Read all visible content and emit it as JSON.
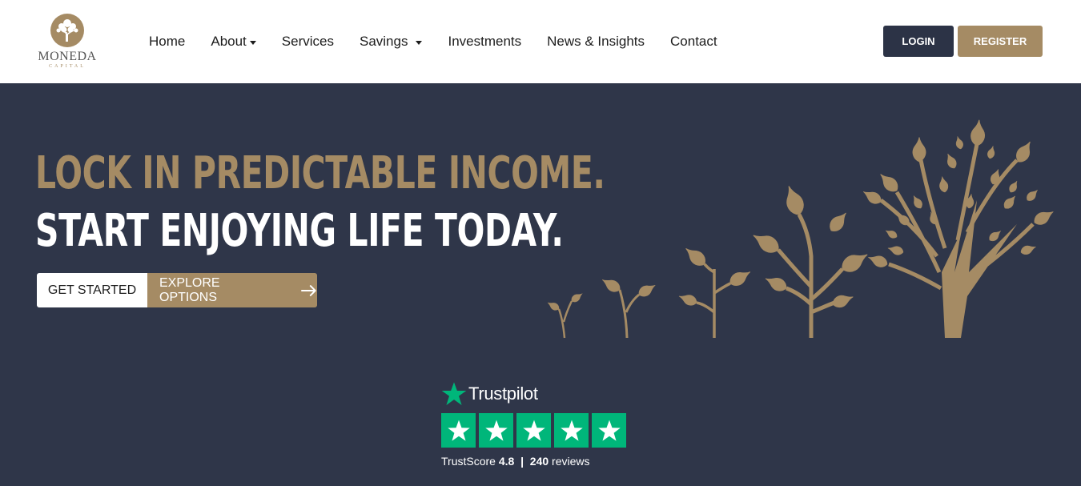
{
  "brand": {
    "name": "MONEDA",
    "sub": "CAPITAL",
    "color_gold": "#a58b64",
    "color_navy": "#2f3649"
  },
  "nav": {
    "items": [
      {
        "label": "Home",
        "dropdown": false
      },
      {
        "label": "About",
        "dropdown": true
      },
      {
        "label": "Services",
        "dropdown": false
      },
      {
        "label": "Savings",
        "dropdown": true
      },
      {
        "label": "Investments",
        "dropdown": false
      },
      {
        "label": "News & Insights",
        "dropdown": false
      },
      {
        "label": "Contact",
        "dropdown": false
      }
    ]
  },
  "auth": {
    "login_label": "LOGIN",
    "register_label": "REGISTER"
  },
  "hero": {
    "headline_1": "LOCK IN PREDICTABLE INCOME.",
    "headline_2": "START ENJOYING LIFE TODAY.",
    "get_started_label": "GET STARTED",
    "explore_label": "EXPLORE OPTIONS",
    "explore_icon": "arrow-right-icon",
    "illustration_icon": "growing-trees-icon"
  },
  "trustpilot": {
    "name": "Trustpilot",
    "star_color": "#00b67a",
    "stars": 5,
    "score_label": "TrustScore",
    "score": "4.8",
    "separator": "|",
    "reviews_count": "240",
    "reviews_label": "reviews"
  }
}
